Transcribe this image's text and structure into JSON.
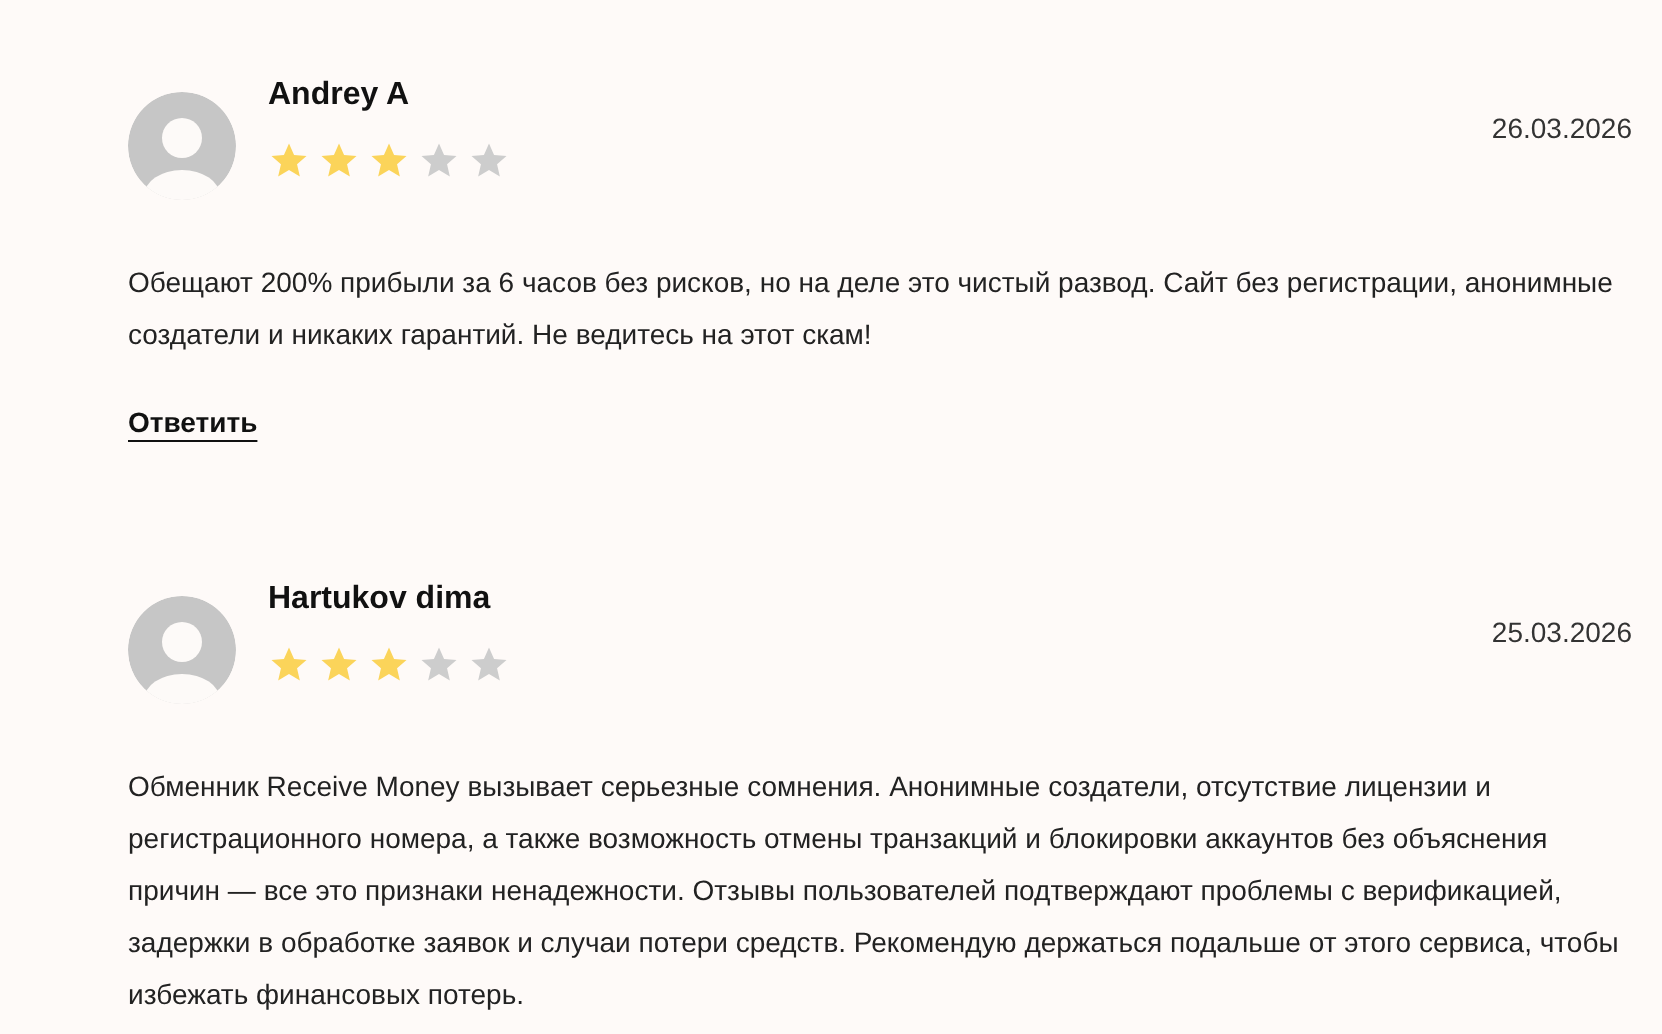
{
  "reviews": [
    {
      "name": "Andrey A",
      "stars": 3,
      "date": "26.03.2026",
      "text": "Обещают 200% прибыли за 6 часов без рисков, но на деле это чистый развод. Сайт без регистрации, анонимные создатели и никаких гарантий. Не ведитесь на этот скам!",
      "reply": "Ответить"
    },
    {
      "name": "Hartukov dima",
      "stars": 3,
      "date": "25.03.2026",
      "text": "Обменник Receive Money вызывает серьезные сомнения. Анонимные создатели, отсутствие лицензии и регистрационного номера, а также возможность отмены транзакций и блокировки аккаунтов без объяснения причин — все это признаки ненадежности. Отзывы пользователей подтверждают проблемы с верификацией, задержки в обработке заявок и случаи потери средств. Рекомендую держаться подальше от этого сервиса, чтобы избежать финансовых потерь."
    }
  ]
}
